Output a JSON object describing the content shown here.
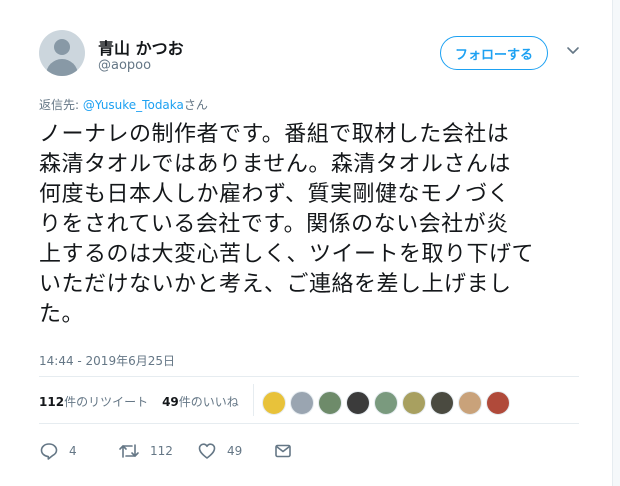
{
  "tweet": {
    "author": {
      "name": "青山 かつお",
      "handle": "@aopoo"
    },
    "follow_label": "フォローする",
    "reply_to": {
      "prefix": "返信先: ",
      "mention": "@Yusuke_Todaka",
      "suffix": "さん"
    },
    "text_lines": [
      "ノーナレの制作者です。番組で取材した会社は",
      "森清タオルではありません。森清タオルさんは",
      "何度も日本人しか雇わず、質実剛健なモノづく",
      "りをされている会社です。関係のない会社が炎",
      "上するのは大変心苦しく、ツイートを取り下げて",
      "いただけないかと考え、ご連絡を差し上げまし",
      "た。"
    ],
    "timestamp": "14:44 - 2019年6月25日",
    "stats": {
      "retweets_count": "112",
      "retweets_label": "件のリツイート",
      "likes_count": "49",
      "likes_label": "件のいいね"
    },
    "actions": {
      "reply_count": "4",
      "retweet_count": "112",
      "like_count": "49"
    },
    "liker_colors": [
      "#e8c23a",
      "#9aa5b1",
      "#6e8b6a",
      "#3b3b3b",
      "#7a9a7e",
      "#a8a060",
      "#4a4a40",
      "#c9a27a",
      "#b04a3a"
    ]
  },
  "colors": {
    "accent": "#1da1f2",
    "muted": "#657786",
    "text": "#14171a"
  }
}
